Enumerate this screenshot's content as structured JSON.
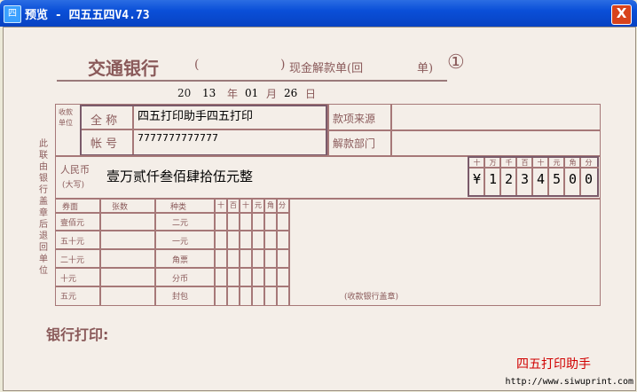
{
  "window": {
    "title": "预览 - 四五五四V4.73",
    "icon_label": "四",
    "close_label": "X"
  },
  "slip": {
    "bank_name": "交通银行",
    "bracket_open": "(",
    "bracket_close": ")",
    "form_name": "现金解款单(回",
    "form_name_end": "单)",
    "copy_number": "①",
    "date": {
      "year_prefix": "20",
      "year": "13",
      "year_label": "年",
      "month": "01",
      "month_label": "月",
      "day": "26",
      "day_label": "日"
    },
    "payee_label": "收款单位",
    "name_label": "全  称",
    "account_label": "帐  号",
    "name_value": "四五打印助手四五打印",
    "account_value": "7777777777777",
    "source_label": "款项来源",
    "dept_label": "解款部门",
    "left_note": "此联由银行盖章后退回单位",
    "currency_label": "人民币",
    "currency_sub": "(大写)",
    "amount_words": "壹万贰仟叁佰肆拾伍元整",
    "units": [
      "十",
      "万",
      "千",
      "百",
      "十",
      "元",
      "角",
      "分"
    ],
    "digits": [
      "¥",
      "1",
      "2",
      "3",
      "4",
      "5",
      "0",
      "0"
    ],
    "denom_header": [
      "券面",
      "张数",
      "种类",
      "十",
      "百",
      "十",
      "元",
      "角",
      "分"
    ],
    "denoms_left": [
      "壹佰元",
      "五十元",
      "二十元",
      "十元",
      "五元"
    ],
    "denoms_right": [
      "二元",
      "一元",
      "角票",
      "分币",
      "封包"
    ],
    "stamp_note": "(收款银行盖章)",
    "bank_print_label": "银行打印:"
  },
  "watermark": {
    "name": "四五打印助手",
    "url": "http://www.siwuprint.com"
  }
}
